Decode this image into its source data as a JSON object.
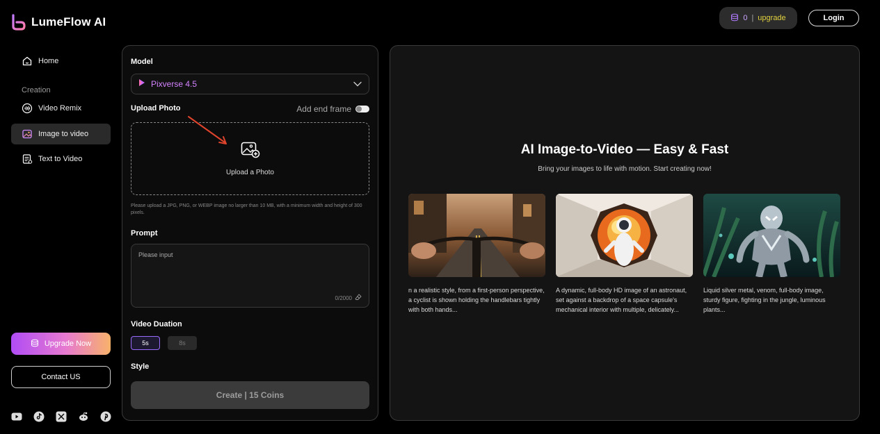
{
  "brand": {
    "name": "LumeFlow AI"
  },
  "sidebar": {
    "home_label": "Home",
    "section_label": "Creation",
    "items": [
      {
        "label": "Video Remix",
        "active": false
      },
      {
        "label": "Image to video",
        "active": true
      },
      {
        "label": "Text to Video",
        "active": false
      }
    ],
    "upgrade_label": "Upgrade Now",
    "contact_label": "Contact US",
    "socials": [
      "youtube-icon",
      "tiktok-icon",
      "x-icon",
      "reddit-icon",
      "pinterest-icon"
    ]
  },
  "header": {
    "coins": "0",
    "separator": "|",
    "upgrade_link": "upgrade",
    "login_label": "Login"
  },
  "form": {
    "model_label": "Model",
    "model_value": "Pixverse 4.5",
    "upload_label": "Upload Photo",
    "end_frame_label": "Add end frame",
    "upload_text": "Upload a Photo",
    "upload_hint": "Please upload a JPG, PNG, or WEBP image no larger than 10 MB, with a minimum width and height of 300 pixels.",
    "prompt_label": "Prompt",
    "prompt_placeholder": "Please input",
    "prompt_counter": "0/2000",
    "duration_label": "Video Duation",
    "durations": [
      "5s",
      "8s"
    ],
    "style_label": "Style",
    "create_label": "Create | 15 Coins"
  },
  "showcase": {
    "title": "AI Image-to-Video — Easy & Fast",
    "subtitle": "Bring your images to life with motion. Start creating now!",
    "cards": [
      {
        "caption": "n a realistic style, from a first-person perspective, a cyclist is shown holding the handlebars tightly with both hands..."
      },
      {
        "caption": "A dynamic, full-body HD image of an astronaut, set against a backdrop of a space capsule's mechanical interior with multiple, delicately..."
      },
      {
        "caption": "Liquid silver metal, venom, full-body image, sturdy figure, fighting in the jungle, luminous plants..."
      }
    ]
  },
  "colors": {
    "accent": "#d483ff",
    "upgrade_text": "#e2d23f",
    "arrow": "#e0442c"
  }
}
